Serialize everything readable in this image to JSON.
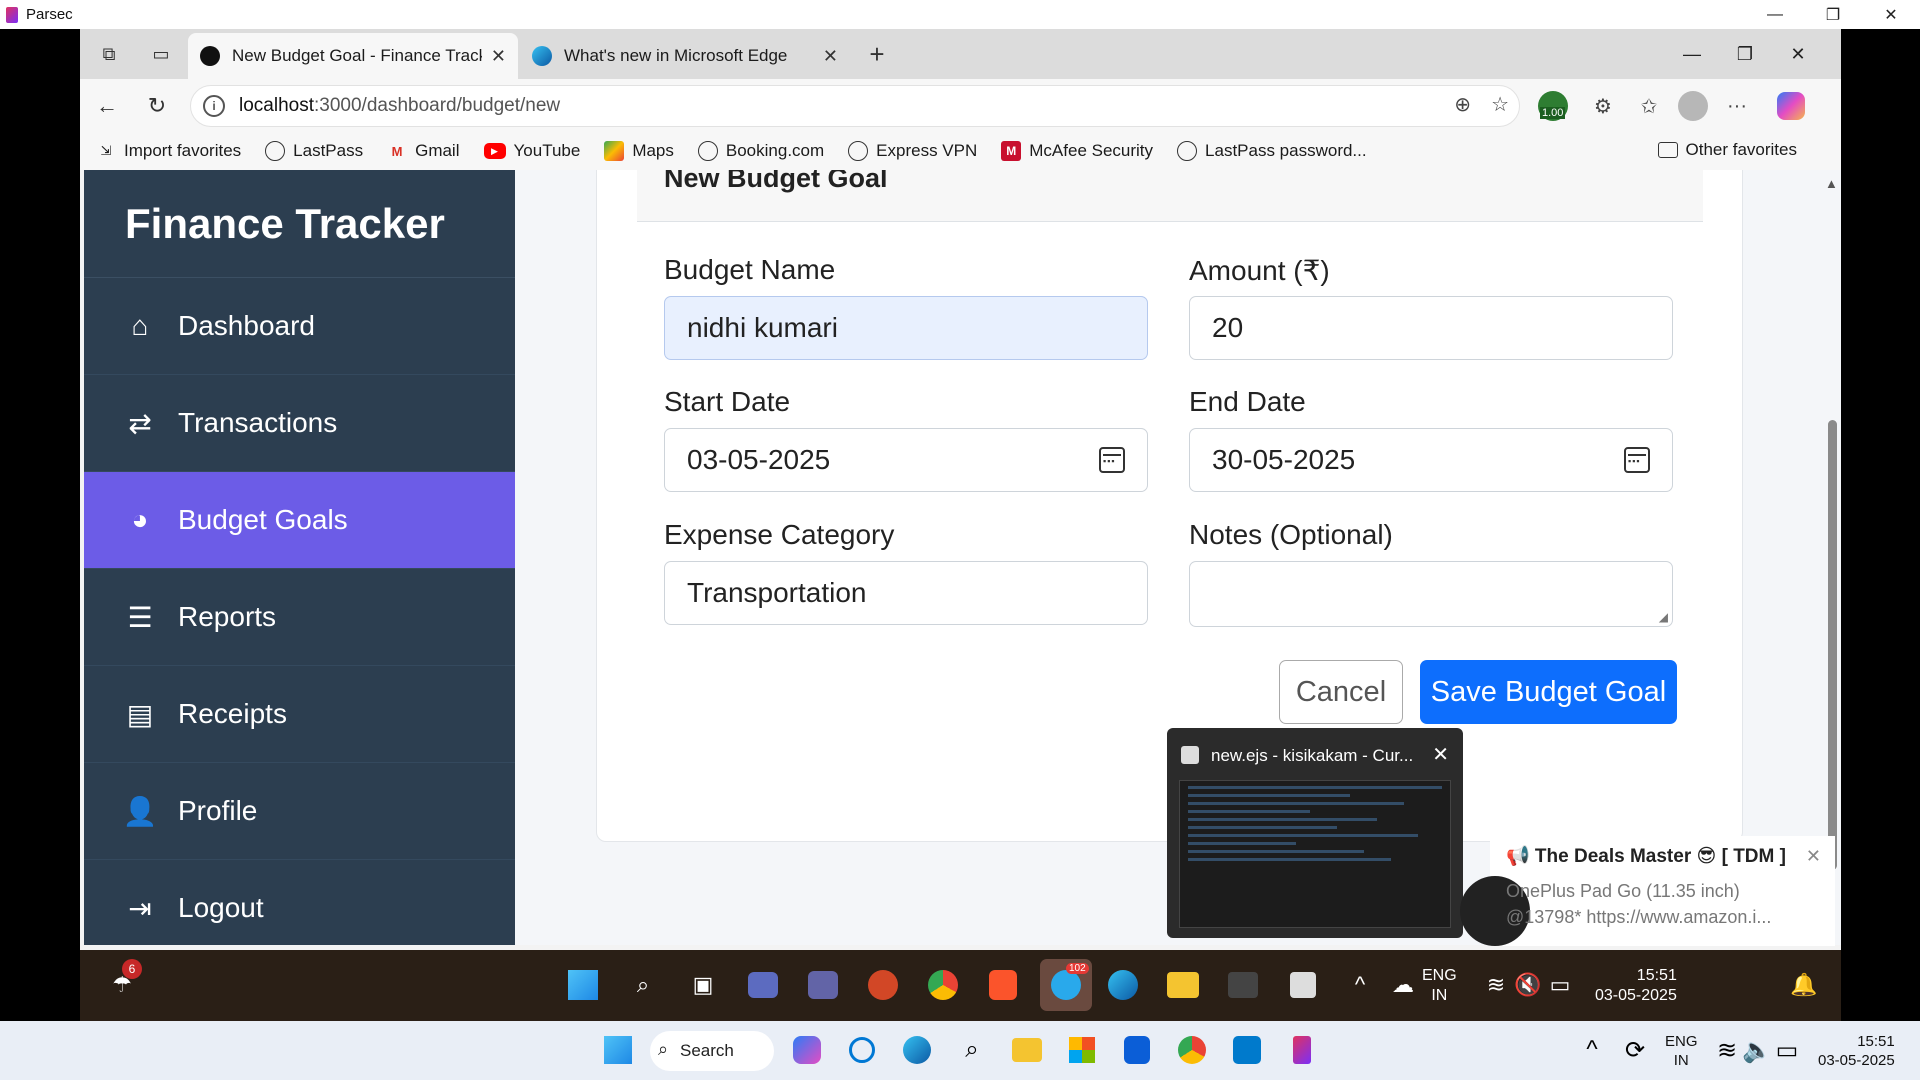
{
  "parsec": {
    "title": "Parsec",
    "controls": [
      "—",
      "❐",
      "✕"
    ]
  },
  "browser": {
    "tabs": [
      {
        "label": "New Budget Goal - Finance Track",
        "active": true
      },
      {
        "label": "What's new in Microsoft Edge",
        "active": false
      }
    ],
    "address": {
      "host": "localhost",
      "path": ":3000/dashboard/budget/new"
    },
    "bookmarks": [
      {
        "label": "Import favorites",
        "icon": "import-icon"
      },
      {
        "label": "LastPass",
        "icon": "globe-icon"
      },
      {
        "label": "Gmail",
        "icon": "gmail-icon"
      },
      {
        "label": "YouTube",
        "icon": "youtube-icon"
      },
      {
        "label": "Maps",
        "icon": "maps-icon"
      },
      {
        "label": "Booking.com",
        "icon": "globe-icon"
      },
      {
        "label": "Express VPN",
        "icon": "globe-icon"
      },
      {
        "label": "McAfee Security",
        "icon": "mcafee-icon"
      },
      {
        "label": "LastPass password...",
        "icon": "globe-icon"
      }
    ],
    "other_favorites": "Other favorites",
    "extension_badge": "1.00"
  },
  "sidebar": {
    "brand": "Finance Tracker",
    "items": [
      {
        "label": "Dashboard",
        "icon": "home-icon"
      },
      {
        "label": "Transactions",
        "icon": "exchange-icon"
      },
      {
        "label": "Budget Goals",
        "icon": "pie-chart-icon",
        "active": true
      },
      {
        "label": "Reports",
        "icon": "bar-chart-icon"
      },
      {
        "label": "Receipts",
        "icon": "receipt-icon"
      },
      {
        "label": "Profile",
        "icon": "user-icon"
      },
      {
        "label": "Logout",
        "icon": "logout-icon"
      }
    ]
  },
  "form": {
    "title": "New Budget Goal",
    "budget_name": {
      "label": "Budget Name",
      "value": "nidhi kumari"
    },
    "amount": {
      "label": "Amount (₹)",
      "value": "20"
    },
    "start_date": {
      "label": "Start Date",
      "value": "03-05-2025"
    },
    "end_date": {
      "label": "End Date",
      "value": "30-05-2025"
    },
    "category": {
      "label": "Expense Category",
      "value": "Transportation"
    },
    "notes": {
      "label": "Notes (Optional)",
      "value": ""
    },
    "cancel": "Cancel",
    "save": "Save Budget Goal"
  },
  "preview": {
    "title": "new.ejs - kisikakam - Cur..."
  },
  "notification": {
    "title": "📢 The Deals Master 😎 [ TDM ]",
    "line1": "OnePlus Pad Go (11.35 inch)",
    "line2": "@13798* https://www.amazon.i..."
  },
  "remote_taskbar": {
    "weather_badge": "6",
    "telegram_badge": "102",
    "lang": "ENG",
    "region": "IN",
    "time": "15:51",
    "date": "03-05-2025"
  },
  "host_taskbar": {
    "search": "Search",
    "lang": "ENG",
    "region": "IN",
    "time": "15:51",
    "date": "03-05-2025"
  }
}
